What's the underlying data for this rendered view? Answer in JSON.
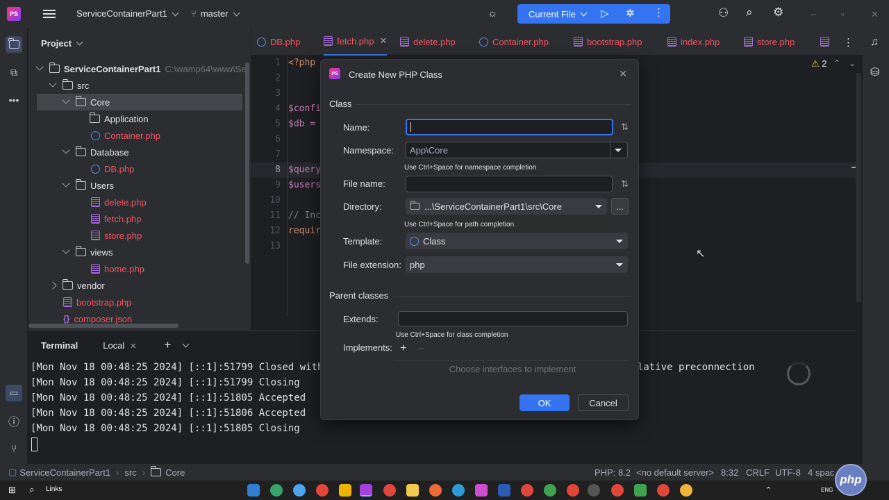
{
  "titlebar": {
    "logo_text": "PS",
    "project_name": "ServiceContainerPart1",
    "branch": "master",
    "run_config": "Current File"
  },
  "project_panel": {
    "title": "Project",
    "root_name": "ServiceContainerPart1",
    "root_path": "C:\\wamp64\\www\\Ser",
    "items": [
      {
        "label": "src",
        "type": "folder"
      },
      {
        "label": "Core",
        "type": "folder"
      },
      {
        "label": "Application",
        "type": "folder"
      },
      {
        "label": "Container.php",
        "type": "class"
      },
      {
        "label": "Database",
        "type": "folder"
      },
      {
        "label": "DB.php",
        "type": "class"
      },
      {
        "label": "Users",
        "type": "folder"
      },
      {
        "label": "delete.php",
        "type": "php"
      },
      {
        "label": "fetch.php",
        "type": "php"
      },
      {
        "label": "store.php",
        "type": "php"
      },
      {
        "label": "views",
        "type": "folder"
      },
      {
        "label": "home.php",
        "type": "php"
      },
      {
        "label": "vendor",
        "type": "folder"
      },
      {
        "label": "bootstrap.php",
        "type": "php"
      },
      {
        "label": "composer.json",
        "type": "json"
      }
    ]
  },
  "editor": {
    "tabs": [
      "DB.php",
      "fetch.php",
      "delete.php",
      "Container.php",
      "bootstrap.php",
      "index.php",
      "store.php"
    ],
    "active_tab": "fetch.php",
    "warnings": "2",
    "lines": [
      "<?php",
      "",
      "",
      "$confi",
      "$db = ",
      "",
      "",
      "$query",
      "$users",
      "",
      "// Inc",
      "requir",
      ""
    ],
    "line_numbers": [
      "1",
      "2",
      "3",
      "4",
      "5",
      "6",
      "7",
      "8",
      "9",
      "10",
      "11",
      "12",
      "13"
    ]
  },
  "terminal": {
    "title": "Terminal",
    "tab": "Local",
    "lines": [
      "[Mon Nov 18 00:48:25 2024] [::1]:51799 Closed withou",
      "[Mon Nov 18 00:48:25 2024] [::1]:51799 Closing",
      "[Mon Nov 18 00:48:25 2024] [::1]:51805 Accepted",
      "[Mon Nov 18 00:48:25 2024] [::1]:51806 Accepted",
      "[Mon Nov 18 00:48:25 2024] [::1]:51805 Closing"
    ],
    "overflow_text": "lative preconnection"
  },
  "dialog": {
    "title": "Create New PHP Class",
    "section_class": "Class",
    "name_label": "Name:",
    "name_value": "",
    "namespace_label": "Namespace:",
    "namespace_value": "App\\Core",
    "namespace_hint": "Use Ctrl+Space for namespace completion",
    "filename_label": "File name:",
    "filename_value": "",
    "directory_label": "Directory:",
    "directory_value": "...\\ServiceContainerPart1\\src\\Core",
    "directory_browse": "...",
    "directory_hint": "Use Ctrl+Space for path completion",
    "template_label": "Template:",
    "template_value": "Class",
    "extension_label": "File extension:",
    "extension_value": "php",
    "section_parent": "Parent classes",
    "extends_label": "Extends:",
    "extends_value": "",
    "extends_hint": "Use Ctrl+Space for class completion",
    "implements_label": "Implements:",
    "implements_placeholder": "Choose interfaces to implement",
    "ok_label": "OK",
    "cancel_label": "Cancel"
  },
  "statusbar": {
    "breadcrumb": [
      "ServiceContainerPart1",
      "src",
      "Core"
    ],
    "php_version": "PHP: 8.2",
    "server": "<no default server>",
    "position": "8:32",
    "line_sep": "CRLF",
    "encoding": "UTF-8",
    "indent": "4 spac"
  },
  "taskbar": {
    "search_text": "Links",
    "lang": "ENG",
    "php_badge": "php"
  }
}
